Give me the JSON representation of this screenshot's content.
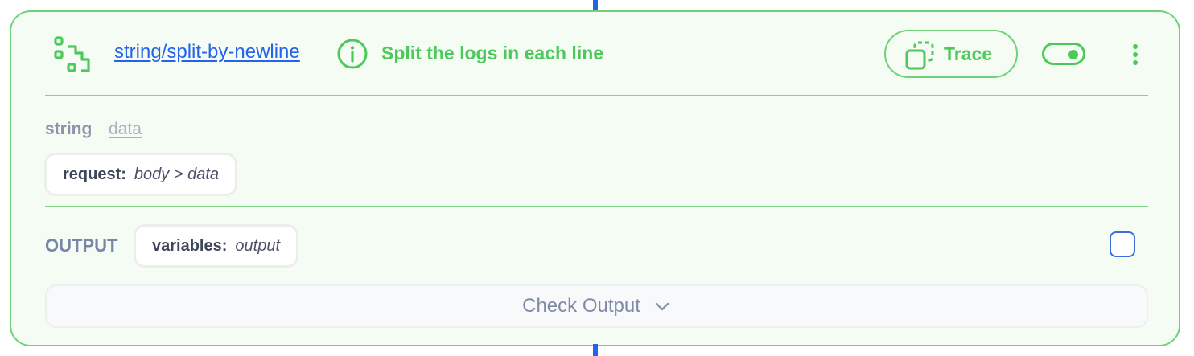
{
  "step": {
    "name": "string/split-by-newline",
    "description": "Split the logs in each line",
    "trace_label": "Trace",
    "enabled": true
  },
  "input": {
    "type": "string",
    "name": "data",
    "source_key": "request:",
    "source_value": "body > data"
  },
  "output": {
    "label": "OUTPUT",
    "target_key": "variables:",
    "target_value": "output",
    "selected": false
  },
  "check_output_label": "Check Output",
  "icons": {
    "step": "stairs-icon",
    "info": "info-icon",
    "trace": "copy-icon",
    "toggle": "toggle-on",
    "menu": "kebab-icon",
    "expand": "chevron-down-icon"
  },
  "colors": {
    "accent": "#4cc95a",
    "border": "#6fd27a",
    "link": "#2563eb",
    "card_bg": "#f5fcf4",
    "connector": "#2563eb"
  }
}
